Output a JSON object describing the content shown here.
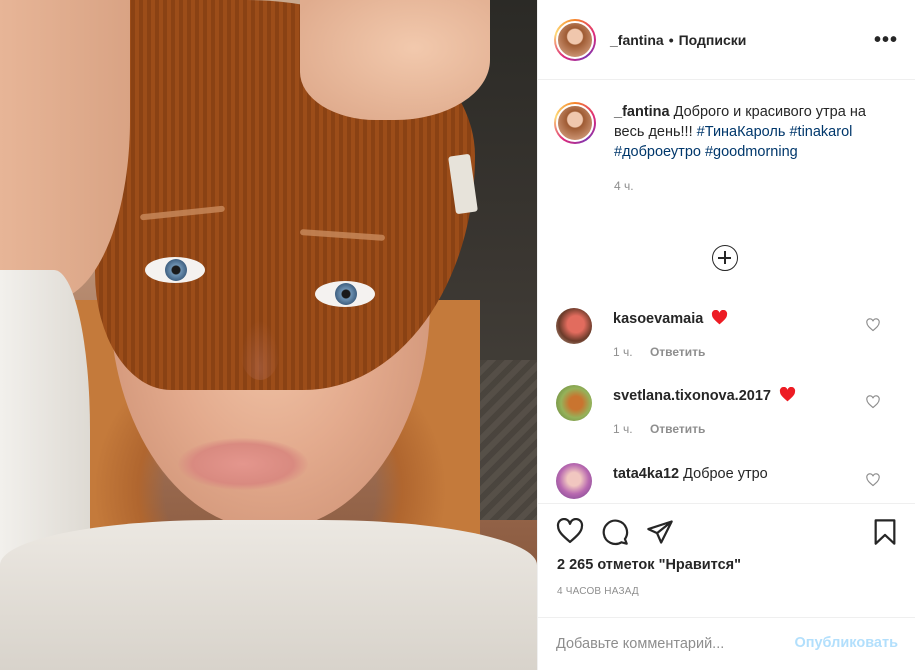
{
  "header": {
    "username": "_fantina",
    "separator": "•",
    "follow_label": "Подписки",
    "more_label": "•••"
  },
  "caption": {
    "username": "_fantina",
    "text": "Доброго и красивого утра на весь день!!!",
    "tags": [
      "#ТинаКароль",
      "#tinakarol",
      "#доброеутро",
      "#goodmorning"
    ],
    "time": "4 ч."
  },
  "comments": [
    {
      "username": "kasoevamaia",
      "text": "",
      "heart": true,
      "time": "1 ч.",
      "reply": "Ответить",
      "avatar_color": "#b2504a"
    },
    {
      "username": "svetlana.tixonova.2017",
      "text": "",
      "heart": true,
      "time": "1 ч.",
      "reply": "Ответить",
      "avatar_color": "#7aa04e"
    },
    {
      "username": "tata4ka12",
      "text": "Доброе утро",
      "heart": false,
      "time": "",
      "reply": "",
      "avatar_color": "#b869b0"
    }
  ],
  "actions": {
    "likes": "2 265 отметок \"Нравится\"",
    "timestamp": "4 часов назад"
  },
  "comment_bar": {
    "placeholder": "Добавьте комментарий...",
    "post_label": "Опубликовать"
  },
  "colors": {
    "accent_link": "#00376b",
    "heart": "#ed4956",
    "post_disabled": "#b2dffc",
    "muted": "#8e8e8e"
  }
}
